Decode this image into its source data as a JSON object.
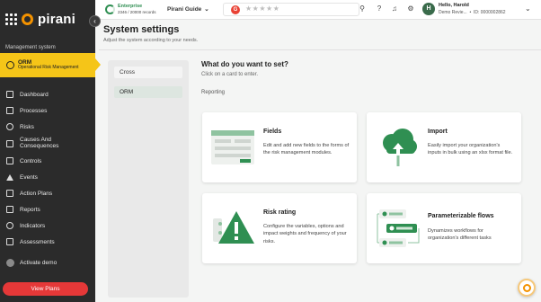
{
  "brand": {
    "logo_text": "pirani",
    "accent": "#f39200"
  },
  "sidebar": {
    "section_label": "Management system",
    "active_module": {
      "title": "ORM",
      "subtitle": "Operational Risk Management",
      "icon": "orm-module-icon",
      "color": "#f5c518"
    },
    "items": [
      {
        "label": "Dashboard",
        "icon": "monitor-icon"
      },
      {
        "label": "Processes",
        "icon": "processes-icon"
      },
      {
        "label": "Risks",
        "icon": "risk-icon"
      },
      {
        "label": "Causes And Consequences",
        "icon": "causes-icon"
      },
      {
        "label": "Controls",
        "icon": "controls-icon"
      },
      {
        "label": "Events",
        "icon": "warning-icon"
      },
      {
        "label": "Action Plans",
        "icon": "action-plans-icon"
      },
      {
        "label": "Reports",
        "icon": "reports-icon"
      },
      {
        "label": "Indicators",
        "icon": "indicators-icon"
      },
      {
        "label": "Assessments",
        "icon": "assessments-icon"
      }
    ],
    "activate_label": "Activate demo",
    "view_plans_label": "View Plans",
    "view_plans_color": "#e53838"
  },
  "topbar": {
    "plan_name": "Enterprise",
    "records": "2346 / 20000 records",
    "guide_label": "Pirani Guide",
    "rating_stars": "★★★★★",
    "rating_value": 0,
    "user_greeting": "Hello, Harold",
    "user_org": "Demo Revie...",
    "user_id": "ID: 0000002862",
    "avatar_initial": "H"
  },
  "page": {
    "title": "System settings",
    "subtitle": "Adjust the system according to your needs."
  },
  "tabs": [
    {
      "label": "Cross",
      "active": false
    },
    {
      "label": "ORM",
      "active": true
    }
  ],
  "content": {
    "question": "What do you want to set?",
    "hint": "Click on a card to enter.",
    "section_label": "Reporting",
    "cards": [
      {
        "title": "Fields",
        "description": "Edit and add new fields to the forms of the risk management modules."
      },
      {
        "title": "Import",
        "description": "Easily import your organization's inputs in bulk using an xlsx format file."
      },
      {
        "title": "Risk rating",
        "description": "Configure the variables, options and impact weights and frequency of your risks."
      },
      {
        "title": "Parameterizable flows",
        "description": "Dynamizes workflows for organization's different tasks"
      }
    ]
  }
}
